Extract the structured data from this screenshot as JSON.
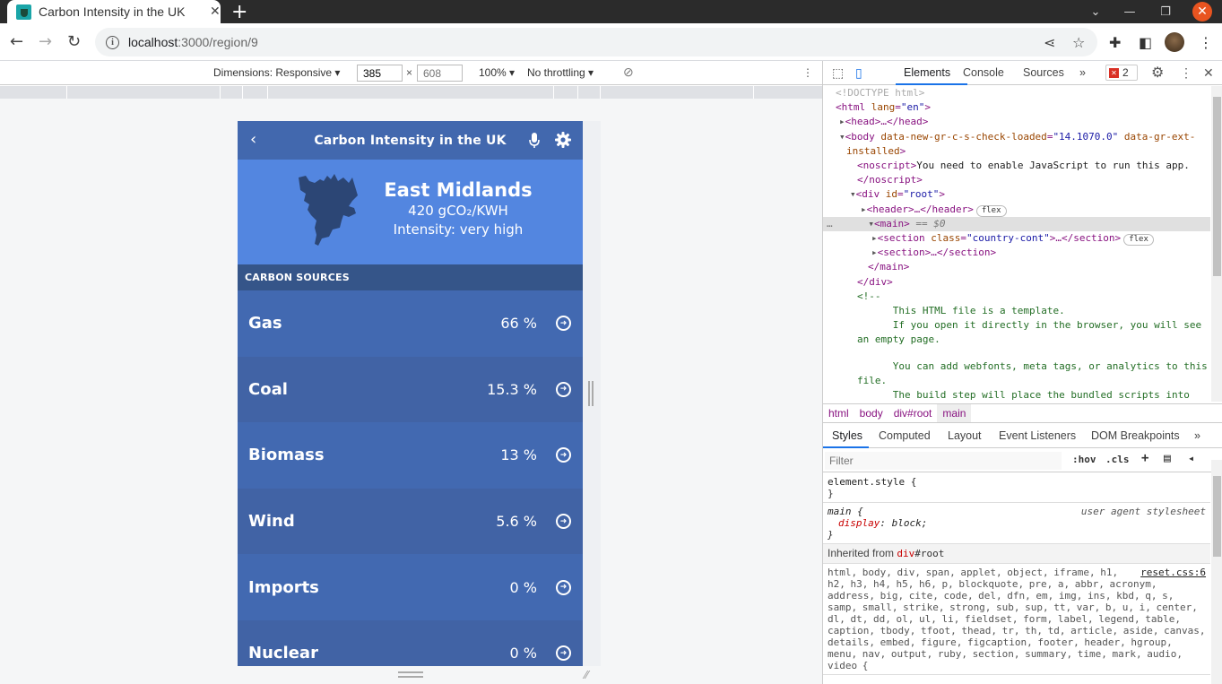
{
  "browser": {
    "tab_title": "Carbon Intensity in the UK",
    "url_host": "localhost",
    "url_path": ":3000/region/9"
  },
  "device_toolbar": {
    "dimensions_label": "Dimensions: Responsive",
    "width": "385",
    "times": "×",
    "height_placeholder": "608",
    "zoom": "100%",
    "throttling": "No throttling"
  },
  "app": {
    "title": "Carbon Intensity in the UK",
    "region": {
      "name": "East Midlands",
      "value": "420 gCO₂/KWH",
      "intensity": "Intensity: very high"
    },
    "sources_header": "CARBON SOURCES",
    "sources": [
      {
        "name": "Gas",
        "percent": "66 %"
      },
      {
        "name": "Coal",
        "percent": "15.3 %"
      },
      {
        "name": "Biomass",
        "percent": "13 %"
      },
      {
        "name": "Wind",
        "percent": "5.6 %"
      },
      {
        "name": "Imports",
        "percent": "0 %"
      },
      {
        "name": "Nuclear",
        "percent": "0 %"
      }
    ],
    "colors": {
      "header": "#4268ae",
      "region_bg": "#5386e0",
      "sources_header_bg": "#355589",
      "row_odd": "#4269b1",
      "row_even": "#4163a5",
      "map_fill": "#2c4675"
    }
  },
  "devtools": {
    "tabs": [
      "Elements",
      "Console",
      "Sources"
    ],
    "more_tabs": "»",
    "error_count": "2",
    "dom": {
      "doctype": "<!DOCTYPE html>",
      "html_open": "<html ",
      "html_attr": "lang",
      "html_val": "\"en\"",
      "head": "<head>…</head>",
      "body_tag": "<body ",
      "body_attr1": "data-new-gr-c-s-check-loaded",
      "body_val1": "\"14.1070.0\"",
      "body_attr2": "data-gr-ext-",
      "body_attr2b": "installed",
      "noscript_open": "<noscript>",
      "noscript_text": "You need to enable JavaScript to run this app.",
      "noscript_close": "</noscript>",
      "div_root_open": "<div ",
      "div_attr": "id",
      "div_val": "\"root\"",
      "header": "<header>…</header>",
      "main_open": "<main>",
      "main_eq": " == $0",
      "section1_open": "<section ",
      "section1_attr": "class",
      "section1_val": "\"country-cont\"",
      "section1_close": ">…</section>",
      "section2": "<section>…</section>",
      "main_close": "</main>",
      "div_close": "</div>",
      "comment_open": "<!--",
      "comment_lines": [
        "      This HTML file is a template.",
        "      If you open it directly in the browser, you will see",
        "an empty page.",
        "",
        "      You can add webfonts, meta tags, or analytics to this",
        "file.",
        "      The build step will place the bundled scripts into"
      ],
      "flex_badge": "flex"
    },
    "breadcrumbs": [
      "html",
      "body",
      "div#root",
      "main"
    ],
    "styles_tabs": [
      "Styles",
      "Computed",
      "Layout",
      "Event Listeners",
      "DOM Breakpoints"
    ],
    "filter_placeholder": "Filter",
    "filter_hov": ":hov",
    "filter_cls": ".cls",
    "styles": {
      "element_style": "element.style {",
      "close_brace": "}",
      "main_selector": "main {",
      "main_source": "user agent stylesheet",
      "main_prop": "display",
      "main_val": "block;",
      "inherited_label": "Inherited from ",
      "inherited_tag": "div",
      "inherited_id": "#root",
      "reset_source": "reset.css:6",
      "reset_selectors": "html, body, div, span, applet, object, iframe, h1, h2, h3, h4, h5, h6, p, blockquote, pre, a, abbr, acronym, address, big, cite, code, del, dfn, em, img, ins, kbd, q, s, samp, small, strike, strong, sub, sup, tt, var, b, u, i, center, dl, dt, dd, ol, ul, li, fieldset, form, label, legend, table, caption, tbody, tfoot, thead, tr, th, td, article, aside, canvas, details, embed, figure, figcaption, footer, header, hgroup, menu, nav, output, ruby, section, summary, time, mark, audio, video {"
    }
  }
}
